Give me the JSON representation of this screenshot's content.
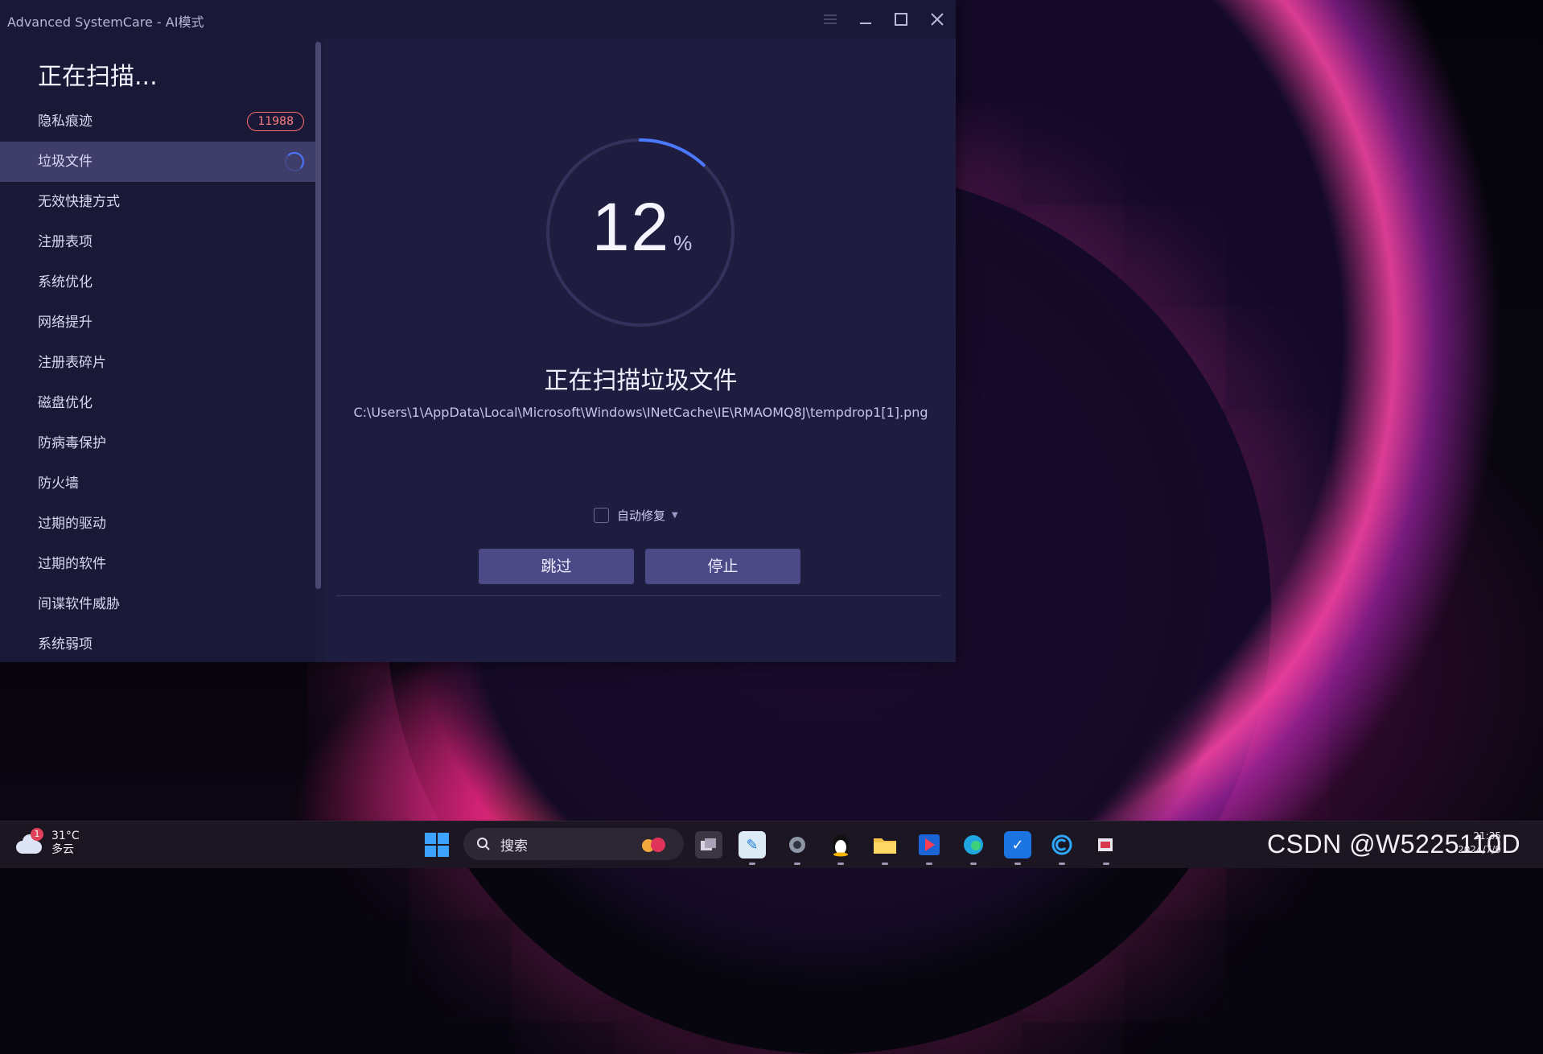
{
  "window": {
    "title": "Advanced SystemCare - AI模式"
  },
  "sidebar": {
    "heading": "正在扫描...",
    "items": [
      {
        "label": "隐私痕迹",
        "badge": "11988"
      },
      {
        "label": "垃圾文件",
        "state": "scanning"
      },
      {
        "label": "无效快捷方式"
      },
      {
        "label": "注册表项"
      },
      {
        "label": "系统优化"
      },
      {
        "label": "网络提升"
      },
      {
        "label": "注册表碎片"
      },
      {
        "label": "磁盘优化"
      },
      {
        "label": "防病毒保护"
      },
      {
        "label": "防火墙"
      },
      {
        "label": "过期的驱动"
      },
      {
        "label": "过期的软件"
      },
      {
        "label": "间谍软件威胁"
      },
      {
        "label": "系统弱项"
      }
    ]
  },
  "main": {
    "progress_value": "12",
    "progress_unit": "%",
    "progress_fraction": 0.12,
    "scan_title": "正在扫描垃圾文件",
    "scan_path": "C:\\Users\\1\\AppData\\Local\\Microsoft\\Windows\\INetCache\\IE\\RMAOMQ8J\\tempdrop1[1].png",
    "auto_fix_label": "自动修复",
    "auto_fix_checked": false,
    "skip_label": "跳过",
    "stop_label": "停止"
  },
  "taskbar": {
    "weather_temp": "31°C",
    "weather_desc": "多云",
    "weather_notification": "1",
    "search_placeholder": "搜索",
    "watermark": "CSDN @W5225110D",
    "date": "2024/7/9",
    "time": "21:35"
  },
  "colors": {
    "accent": "#4a78ff",
    "badge_red": "#ff6d6d",
    "button": "#4c4a86",
    "window_bg": "#1d1b3b"
  }
}
